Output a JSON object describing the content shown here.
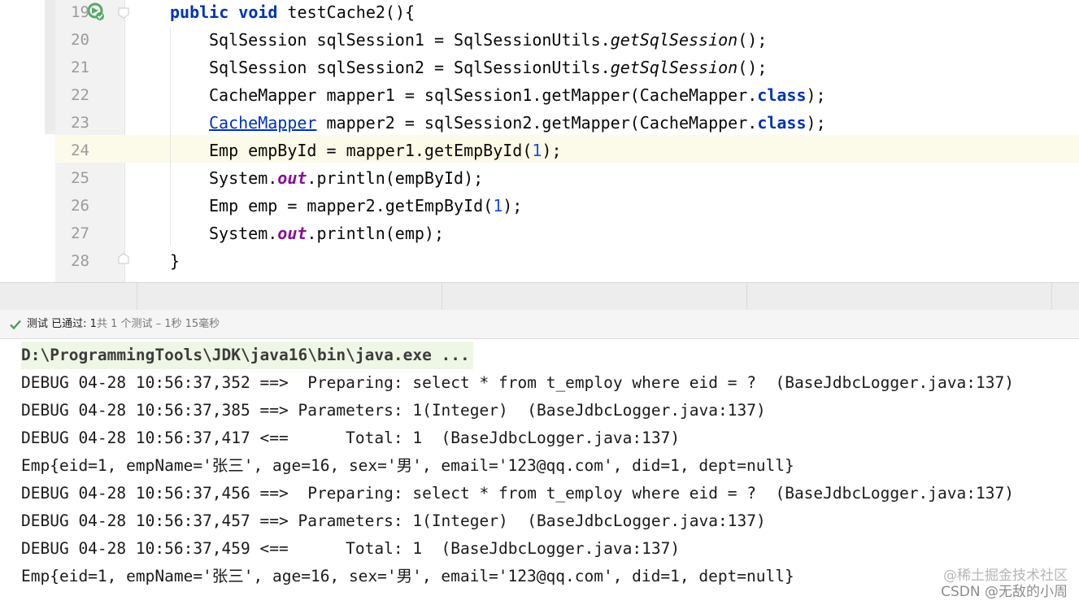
{
  "editor": {
    "lines": [
      {
        "num": "19",
        "indent": 0,
        "segments": [
          {
            "t": "public ",
            "c": "kwb"
          },
          {
            "t": "void ",
            "c": "kwb"
          },
          {
            "t": "testCache2(){",
            "c": ""
          }
        ]
      },
      {
        "num": "20",
        "indent": 1,
        "segments": [
          {
            "t": "SqlSession sqlSession1 = SqlSessionUtils.",
            "c": ""
          },
          {
            "t": "getSqlSession",
            "c": "static-call"
          },
          {
            "t": "();",
            "c": ""
          }
        ]
      },
      {
        "num": "21",
        "indent": 1,
        "segments": [
          {
            "t": "SqlSession sqlSession2 = SqlSessionUtils.",
            "c": ""
          },
          {
            "t": "getSqlSession",
            "c": "static-call"
          },
          {
            "t": "();",
            "c": ""
          }
        ]
      },
      {
        "num": "22",
        "indent": 1,
        "segments": [
          {
            "t": "CacheMapper mapper1 = sqlSession1.getMapper(CacheMapper.",
            "c": ""
          },
          {
            "t": "class",
            "c": "kwb"
          },
          {
            "t": ");",
            "c": ""
          }
        ]
      },
      {
        "num": "23",
        "indent": 1,
        "segments": [
          {
            "t": "CacheMapper",
            "c": "err-ref"
          },
          {
            "t": " mapper2 = sqlSession2.getMapper(CacheMapper.",
            "c": ""
          },
          {
            "t": "class",
            "c": "kwb"
          },
          {
            "t": ");",
            "c": ""
          }
        ]
      },
      {
        "num": "24",
        "indent": 1,
        "segments": [
          {
            "t": "Emp empById = mapper1.getEmpById(",
            "c": ""
          },
          {
            "t": "1",
            "c": "num"
          },
          {
            "t": ");",
            "c": ""
          }
        ]
      },
      {
        "num": "25",
        "indent": 1,
        "segments": [
          {
            "t": "System.",
            "c": ""
          },
          {
            "t": "out",
            "c": "field"
          },
          {
            "t": ".println(empById);",
            "c": ""
          }
        ]
      },
      {
        "num": "26",
        "indent": 1,
        "segments": [
          {
            "t": "Emp emp = mapper2.getEmpById(",
            "c": ""
          },
          {
            "t": "1",
            "c": "num"
          },
          {
            "t": ");",
            "c": ""
          }
        ]
      },
      {
        "num": "27",
        "indent": 1,
        "segments": [
          {
            "t": "System.",
            "c": ""
          },
          {
            "t": "out",
            "c": "field"
          },
          {
            "t": ".println(emp);",
            "c": ""
          }
        ]
      },
      {
        "num": "28",
        "indent": 0,
        "segments": [
          {
            "t": "}",
            "c": ""
          }
        ]
      }
    ],
    "current_line": "24",
    "icons": {
      "run": "run-test-icon",
      "fold": "fold-marker-icon"
    }
  },
  "test_status": {
    "label": "测试 已通过: ",
    "passed_count": "1",
    "rest": "共 1 个测试 – 1秒 15毫秒",
    "icon": "check-icon",
    "color": "#4a9f5b"
  },
  "console": {
    "command": "D:\\ProgrammingTools\\JDK\\java16\\bin\\java.exe ...",
    "lines": [
      "DEBUG 04-28 10:56:37,352 ==>  Preparing: select * from t_employ where eid = ?  (BaseJdbcLogger.java:137)",
      "DEBUG 04-28 10:56:37,385 ==> Parameters: 1(Integer)  (BaseJdbcLogger.java:137)",
      "DEBUG 04-28 10:56:37,417 <==      Total: 1  (BaseJdbcLogger.java:137)",
      "Emp{eid=1, empName='张三', age=16, sex='男', email='123@qq.com', did=1, dept=null}",
      "DEBUG 04-28 10:56:37,456 ==>  Preparing: select * from t_employ where eid = ?  (BaseJdbcLogger.java:137)",
      "DEBUG 04-28 10:56:37,457 ==> Parameters: 1(Integer)  (BaseJdbcLogger.java:137)",
      "DEBUG 04-28 10:56:37,459 <==      Total: 1  (BaseJdbcLogger.java:137)",
      "Emp{eid=1, empName='张三', age=16, sex='男', email='123@qq.com', did=1, dept=null}"
    ]
  },
  "watermark": {
    "line1": "@稀土掘金技术社区",
    "line2": "CSDN @无敌的小周"
  }
}
